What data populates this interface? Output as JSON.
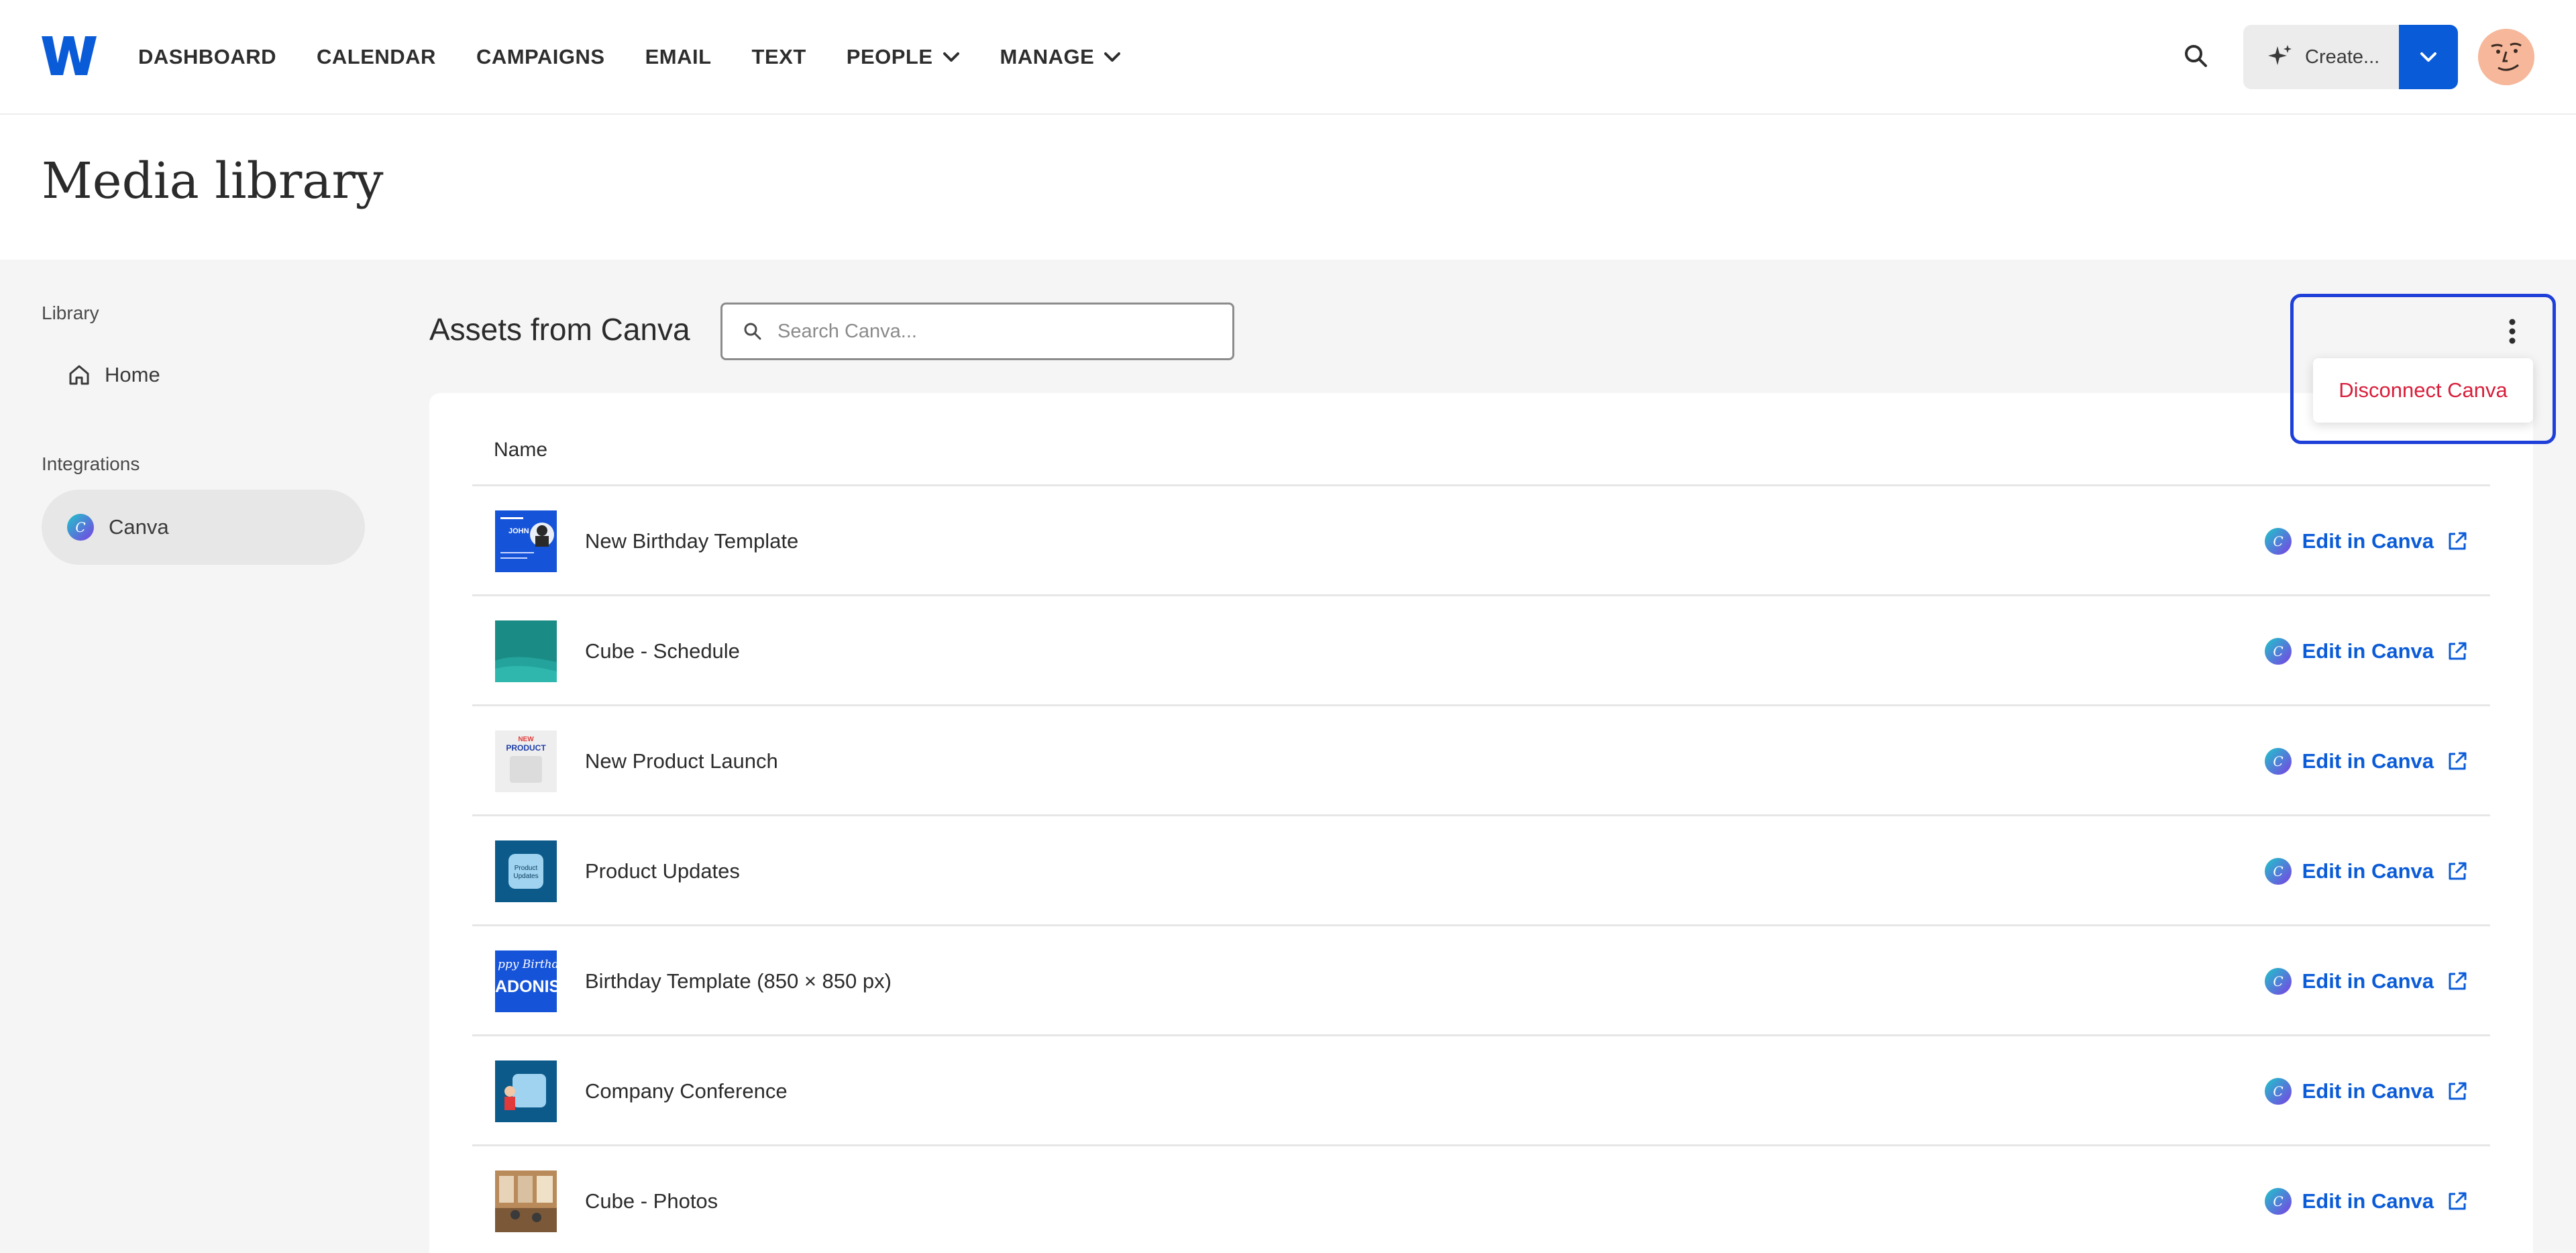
{
  "nav": {
    "logo_alt": "W",
    "items": [
      {
        "label": "DASHBOARD",
        "dropdown": false
      },
      {
        "label": "CALENDAR",
        "dropdown": false
      },
      {
        "label": "CAMPAIGNS",
        "dropdown": false
      },
      {
        "label": "EMAIL",
        "dropdown": false
      },
      {
        "label": "TEXT",
        "dropdown": false
      },
      {
        "label": "PEOPLE",
        "dropdown": true
      },
      {
        "label": "MANAGE",
        "dropdown": true
      }
    ],
    "create_label": "Create...",
    "accent_color": "#0a5bd8"
  },
  "page": {
    "title": "Media library"
  },
  "sidebar": {
    "library_heading": "Library",
    "home_label": "Home",
    "integrations_heading": "Integrations",
    "canva_label": "Canva"
  },
  "main": {
    "section_title": "Assets from Canva",
    "search_placeholder": "Search Canva...",
    "column_name": "Name",
    "edit_label": "Edit in Canva",
    "menu_option": "Disconnect Canva",
    "rows": [
      {
        "name": "New Birthday Template",
        "thumb": "birthday-blue"
      },
      {
        "name": "Cube - Schedule",
        "thumb": "teal-waves"
      },
      {
        "name": "New Product Launch",
        "thumb": "product-launch"
      },
      {
        "name": "Product Updates",
        "thumb": "product-updates"
      },
      {
        "name": "Birthday Template (850 × 850 px)",
        "thumb": "birthday-adonis"
      },
      {
        "name": "Company Conference",
        "thumb": "conference"
      },
      {
        "name": "Cube - Photos",
        "thumb": "photos"
      }
    ]
  }
}
